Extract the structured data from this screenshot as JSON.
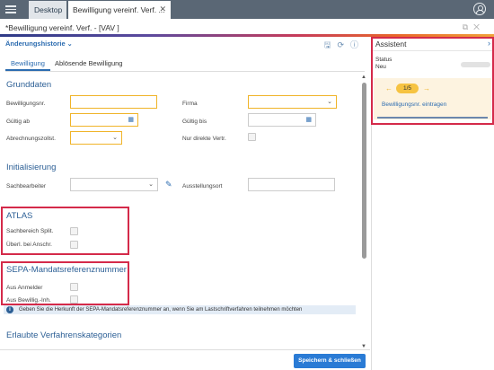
{
  "topbar": {
    "tabs": [
      {
        "label": "Desktop"
      },
      {
        "label": "Bewilligung vereinf. Verf. ..."
      }
    ]
  },
  "window": {
    "title": "*Bewilligung vereinf. Verf. - [VAV ]"
  },
  "main": {
    "history_label": "Änderungshistorie",
    "subtabs": [
      {
        "label": "Bewilligung"
      },
      {
        "label": "Ablösende Bewilligung"
      }
    ],
    "sections": {
      "grunddaten": "Grunddaten",
      "initialisierung": "Initialisierung",
      "atlas": "ATLAS",
      "sepa": "SEPA-Mandatsreferenznummer",
      "verfahren": "Erlaubte Verfahrenskategorien"
    },
    "fields": {
      "bewilligungsnr": "Bewilligungsnr.",
      "gueltig_ab": "Gültig ab",
      "abrechnungszollst": "Abrechnungszollst.",
      "firma": "Firma",
      "gueltig_bis": "Gültig bis",
      "nur_direkte": "Nur direkte Vertr.",
      "sachbearbeiter": "Sachbearbeiter",
      "ausstellungsort": "Ausstellungsort",
      "sachbereich": "Sachbereich Split.",
      "ueberl": "Überl. bei Anschr.",
      "aus_anmelder": "Aus Anmelder",
      "aus_bewillig": "Aus Bewillig.-Inh."
    },
    "info_text": "Geben Sie die Herkunft der SEPA-Mandatsreferenznummer an, wenn Sie am Lastschriftverfahren teilnehmen möchten",
    "save_button": "Speichern & schließen"
  },
  "assistant": {
    "title": "Assistent",
    "status_label": "Status",
    "status_value": "Neu",
    "pagination": "1/5",
    "task_link": "Bewilligungsnr. eintragen"
  },
  "colors": {
    "accent": "#2c6cb0",
    "required_border": "#f0b429",
    "highlight": "#d42a4a",
    "topbar": "#5a6775",
    "save_button": "#2a7bd5"
  }
}
